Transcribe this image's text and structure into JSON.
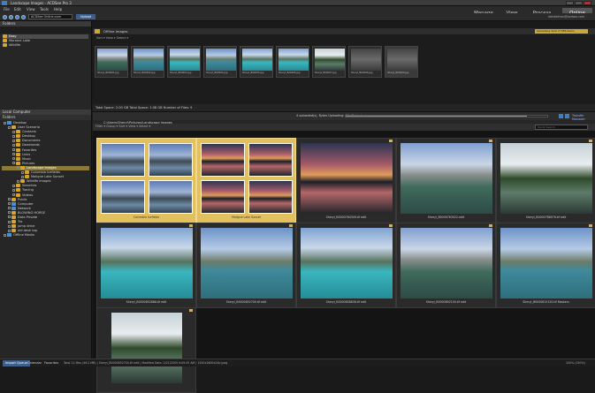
{
  "window": {
    "title": "Landscape Images - ACDSee Pro 3"
  },
  "menu": [
    "File",
    "Edit",
    "View",
    "Tools",
    "Help"
  ],
  "modes": [
    "Manage",
    "View",
    "Process",
    "Online"
  ],
  "toolbar": {
    "path_field": "ACDSee Online.com",
    "go_label": "Upload",
    "account": "ddinkelman@acdsee.com"
  },
  "favorites": {
    "header": "Folders",
    "items": [
      "Easy",
      "Moraine Lake",
      "Wildlife"
    ]
  },
  "easy_select": {
    "header": "Local Computer"
  },
  "tree": {
    "header": "Folders",
    "items": [
      {
        "label": "Desktop",
        "indent": 0,
        "type": "drive"
      },
      {
        "label": "User Scenario",
        "indent": 1,
        "type": "folder"
      },
      {
        "label": "Contacts",
        "indent": 2,
        "type": "folder"
      },
      {
        "label": "Desktop",
        "indent": 2,
        "type": "folder"
      },
      {
        "label": "Documents",
        "indent": 2,
        "type": "folder"
      },
      {
        "label": "Downloads",
        "indent": 2,
        "type": "folder"
      },
      {
        "label": "Favorites",
        "indent": 2,
        "type": "folder"
      },
      {
        "label": "Links",
        "indent": 2,
        "type": "folder"
      },
      {
        "label": "Music",
        "indent": 2,
        "type": "folder"
      },
      {
        "label": "Pictures",
        "indent": 2,
        "type": "folder"
      },
      {
        "label": "Landscape Images",
        "indent": 3,
        "type": "folder",
        "selected": true
      },
      {
        "label": "Columbia Icefields",
        "indent": 4,
        "type": "folder"
      },
      {
        "label": "Maligne Lake Sunset",
        "indent": 4,
        "type": "folder"
      },
      {
        "label": "Wildlife Images",
        "indent": 3,
        "type": "folder"
      },
      {
        "label": "Searches",
        "indent": 2,
        "type": "folder"
      },
      {
        "label": "Tracing",
        "indent": 2,
        "type": "folder"
      },
      {
        "label": "Videos",
        "indent": 2,
        "type": "folder"
      },
      {
        "label": "Public",
        "indent": 1,
        "type": "folder"
      },
      {
        "label": "Computer",
        "indent": 1,
        "type": "drive"
      },
      {
        "label": "Network",
        "indent": 1,
        "type": "drive"
      },
      {
        "label": "BLOWING HORSE",
        "indent": 1,
        "type": "folder"
      },
      {
        "label": "Data Private",
        "indent": 1,
        "type": "folder"
      },
      {
        "label": "Tro",
        "indent": 1,
        "type": "folder"
      },
      {
        "label": "jump drive",
        "indent": 1,
        "type": "folder"
      },
      {
        "label": "old desk top",
        "indent": 1,
        "type": "folder"
      },
      {
        "label": "Offline Media",
        "indent": 0,
        "type": "drive"
      }
    ]
  },
  "upload": {
    "header": "Offline Images",
    "subbar": "Sort ▾  View ▾  Select ▾",
    "right_link": "Uploading 4/10 of 386 items",
    "films": [
      "Sheryl_B00001.jpg",
      "Sheryl_B00002.jpg",
      "Sheryl_B00003.jpg",
      "Sheryl_B00004.jpg",
      "Sheryl_B00005.jpg",
      "Sheryl_B00006.jpg",
      "Sheryl_B00007.jpg",
      "Sheryl_B00008.jpg",
      "Sheryl_B00009.jpg"
    ],
    "status": "Total Space: 2.00 GB  Total Space: 1.08 GB  Number of Files: 9",
    "progress_label": "4 uploaded(s), Bytes Uploading: 0% (Bytes)",
    "progress_value": 0.9,
    "transfer_label": "Transfer Manager"
  },
  "grid": {
    "path": "C:\\Users\\Sheryl\\Pictures\\Landscape Images",
    "bar": "Filter ▾  Group ▾  Sort ▾  View ▾  Select ▾",
    "search_placeholder": "Quick Search",
    "cells": [
      {
        "caption": "Columbia Icefields",
        "kind": "folder",
        "palette": "sky1"
      },
      {
        "caption": "Maligne Lake Sunset",
        "kind": "folder",
        "palette": "sunset"
      },
      {
        "caption": "Sheryl_B0000764349.tif edit",
        "kind": "image",
        "palette": "sunset"
      },
      {
        "caption": "Sheryl_B0000763022-edit",
        "kind": "image",
        "palette": "mtn"
      },
      {
        "caption": "Sheryl_B0000788076.tif edit",
        "kind": "image",
        "palette": "forest"
      },
      {
        "caption": "Sheryl_B0000852688.tif edit",
        "kind": "image",
        "palette": "teal"
      },
      {
        "caption": "Sheryl_B0000852700.tif edit",
        "kind": "image",
        "palette": "lake"
      },
      {
        "caption": "Sheryl_B0000858838.tif edit",
        "kind": "image",
        "palette": "teal"
      },
      {
        "caption": "Sheryl_B0000852100.tif edit",
        "kind": "image",
        "palette": "mtn"
      },
      {
        "caption": "Sheryl_B0000813120.tif Maskers",
        "kind": "image",
        "palette": "lake"
      },
      {
        "caption": "",
        "kind": "image",
        "palette": "forest"
      }
    ]
  },
  "bottom": {
    "tabs": [
      "Import Queue",
      "Calendar",
      "Favorites"
    ],
    "status": "Total 11 files (46.2 MB)  |  Sheryl_B0000852700.tif edit  |  Modified Date: 2/21/2009 9:09:45 AM  |  1200x1600x24b jpeg",
    "right_status": "100% (150%)"
  },
  "colors": {
    "accent": "#3fbf3f",
    "folder": "#d6a62b",
    "selection": "#e2c05e"
  }
}
